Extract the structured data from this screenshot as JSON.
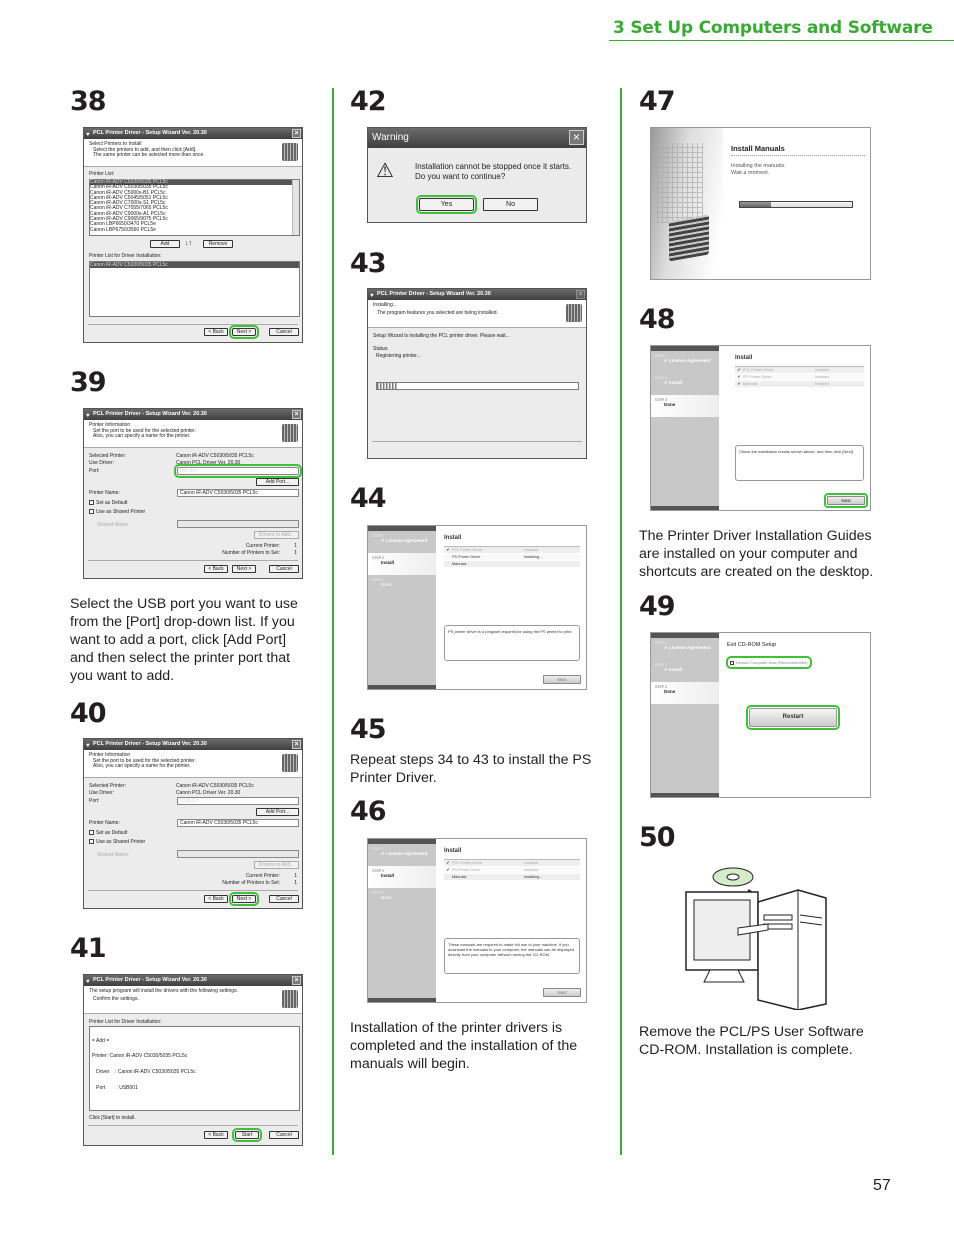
{
  "header": {
    "title": "3 Set Up Computers and Software"
  },
  "accent_color": "#3aa935",
  "page_number": "57",
  "wizard_title": "PCL Printer Driver - Setup Wizard Ver. 20.30",
  "buttons": {
    "back": "< Back",
    "next": "Next >",
    "cancel": "Cancel",
    "start": "Start",
    "add": "Add",
    "remove": "Remove",
    "add_port": "Add Port...",
    "drivers_to_add": "Drivers to Add...",
    "yes": "Yes",
    "no": "No",
    "next_installer": "Next",
    "restart": "Restart"
  },
  "s38": {
    "num": "38",
    "head_title": "Select Printers to Install",
    "head_sub1": "Select the printers to add, and then click [Add].",
    "head_sub2": "The same printer can be selected more than once.",
    "list_label": "Printer List:",
    "printers": [
      "Canon iR-ADV C5030/5035 PCL5c",
      "Canon iR-ADV C5030/5035 PCL5c",
      "Canon iR-ADV C5000s-B1 PCL5c",
      "Canon iR-ADV C5045/5051 PCL5c",
      "Canon iR-ADV C7000s-S1 PCL5c",
      "Canon iR-ADV C7055/7065 PCL5c",
      "Canon iR-ADV C9000s-A1 PCL5c",
      "Canon iR-ADV C9065/9075 PCL5c",
      "Canon LBP6650/3470 PCL5e",
      "Canon LBP6750/3560 PCL5e"
    ],
    "arrows": "↓↑",
    "install_label": "Printer List for Driver Installation:",
    "install_item": "Canon iR-ADV C5030/5035 PCL5c"
  },
  "info": {
    "head_title": "Printer Information",
    "head_sub1": "Set the port to be used for the selected printer.",
    "head_sub2": "Also, you can specify a name for the printer.",
    "selected_label": "Selected Printer:",
    "selected_value": "Canon iR-ADV C5030/5035 PCL5c",
    "driver_label": "Use Driver:",
    "driver_value": "Canon PCL Driver Ver. 20.30",
    "port_label": "Port:",
    "name_label": "Printer Name:",
    "name_value": "Canon iR-ADV C5030/5035 PCL5c",
    "default_label": "Set as Default",
    "shared_label": "Use as Shared Printer",
    "share_name_label": "Shared Name:",
    "current_label": "Current Printer:",
    "current_value": "1",
    "count_label": "Number of Printers to Set:",
    "count_value": "1"
  },
  "s39": {
    "num": "39",
    "port_value": "Not Set",
    "caption": [
      "Select the USB port you want to use",
      "from the [Port] drop-down list. If you",
      "want to add a port, click [Add Port]",
      "and then select the printer port that",
      "you want to add."
    ]
  },
  "s40": {
    "num": "40",
    "port_value": "USB001"
  },
  "s41": {
    "num": "41",
    "head_title": "The setup program will install the drivers with the following settings.",
    "head_sub": "Confirm the settings.",
    "list_label": "Printer List for Driver Installation:",
    "lines": [
      "= Add =",
      "Printer: Canon iR-ADV C5030/5035 PCL5c",
      "   Driver    : Canon iR-ADV C5030/5035 PCL5c",
      "   Port        : USB001"
    ],
    "footer": "Click [Start] to install."
  },
  "s42": {
    "num": "42",
    "title": "Warning",
    "line1": "Installation cannot be stopped once it starts.",
    "line2": "Do you want to continue?"
  },
  "s43": {
    "num": "43",
    "head_title": "Installing...",
    "head_sub": "The program features you selected are being installed.",
    "body": "Setup Wizard is installing the PCL printer driver. Please wait...",
    "status_label": "Status:",
    "status_value": "Registering printer...",
    "progress": 0.1
  },
  "steps": {
    "s1": "STEP 1",
    "s1_label": "License Agreement",
    "s2": "STEP 2",
    "s2_label": "Install",
    "s3": "STEP 3",
    "s3_label": "Done"
  },
  "install_title": "Install",
  "items": {
    "pcl": "PCL Printer Driver",
    "ps": "PS Printer Driver",
    "manuals": "Manuals",
    "installed": "Installed",
    "installing": "Installing..."
  },
  "s44": {
    "num": "44",
    "message": "PS printer driver is a program required for using the PS printer to print."
  },
  "s45": {
    "num": "45",
    "caption": [
      "Repeat steps 34 to 43 to install the PS",
      "Printer Driver."
    ]
  },
  "s46": {
    "num": "46",
    "message": "These manuals are required to make full use of your machine. If you download the manuals to your computer, the manuals can be displayed directly from your computer without running the CD-ROM.",
    "caption": [
      "Installation of the printer drivers is",
      "completed and the installation of the",
      "manuals will begin."
    ]
  },
  "s47": {
    "num": "47",
    "title": "Install Manuals",
    "line1": "Installing the manuals.",
    "line2": "Wait a moment.",
    "progress": 0.28
  },
  "s48": {
    "num": "48",
    "message": "Check the installation results shown above, and then click [Next].",
    "caption": [
      "The Printer Driver Installation Guides",
      "are installed on your computer and",
      "shortcuts are created on the desktop."
    ]
  },
  "s49": {
    "num": "49",
    "title": "Exit CD-ROM Setup",
    "checkbox": "Restart Computer Now (Recommended)"
  },
  "s50": {
    "num": "50",
    "caption": [
      "Remove the PCL/PS User Software",
      "CD-ROM. Installation is complete."
    ]
  },
  "icons": {
    "cd": "cd-rom-icon",
    "computer": "computer-illustration",
    "warning": "warning-icon",
    "check": "checkmark-icon"
  }
}
